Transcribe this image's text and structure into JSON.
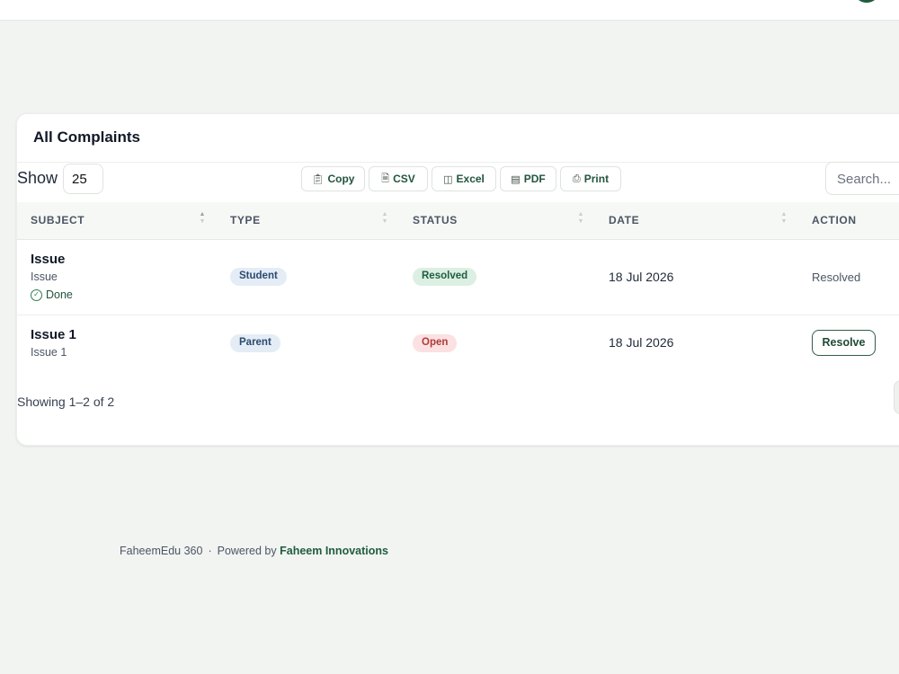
{
  "card": {
    "title": "All Complaints"
  },
  "controls": {
    "show_label": "Show",
    "page_size": "25",
    "search_placeholder": "Search...",
    "export_buttons": [
      {
        "label": "Copy",
        "icon": "copy-icon"
      },
      {
        "label": "CSV",
        "icon": "csv-file-icon"
      },
      {
        "label": "Excel",
        "icon": "excel-file-icon"
      },
      {
        "label": "PDF",
        "icon": "pdf-file-icon"
      },
      {
        "label": "Print",
        "icon": "printer-icon"
      }
    ]
  },
  "table": {
    "columns": [
      "SUBJECT",
      "TYPE",
      "STATUS",
      "DATE",
      "ACTION"
    ],
    "rows": [
      {
        "subject_title": "Issue",
        "subject_desc": "Issue",
        "subject_note": "Done",
        "type": "Student",
        "status": "Resolved",
        "date": "18 Jul 2026",
        "action": "Resolved"
      },
      {
        "subject_title": "Issue 1",
        "subject_desc": "Issue 1",
        "type": "Parent",
        "status": "Open",
        "date": "18 Jul 2026",
        "action": "Resolve"
      }
    ]
  },
  "pagination": {
    "summary": "Showing 1–2 of 2"
  },
  "footer": {
    "app_name": "FaheemEdu 360",
    "separator": "·",
    "powered_by": "Powered by",
    "company": "Faheem Innovations"
  },
  "colors": {
    "brand": "#1f5c3e",
    "resolved_bg": "#dcefe3",
    "open_bg": "#fbe1e1",
    "type_bg": "#e4edf6"
  }
}
